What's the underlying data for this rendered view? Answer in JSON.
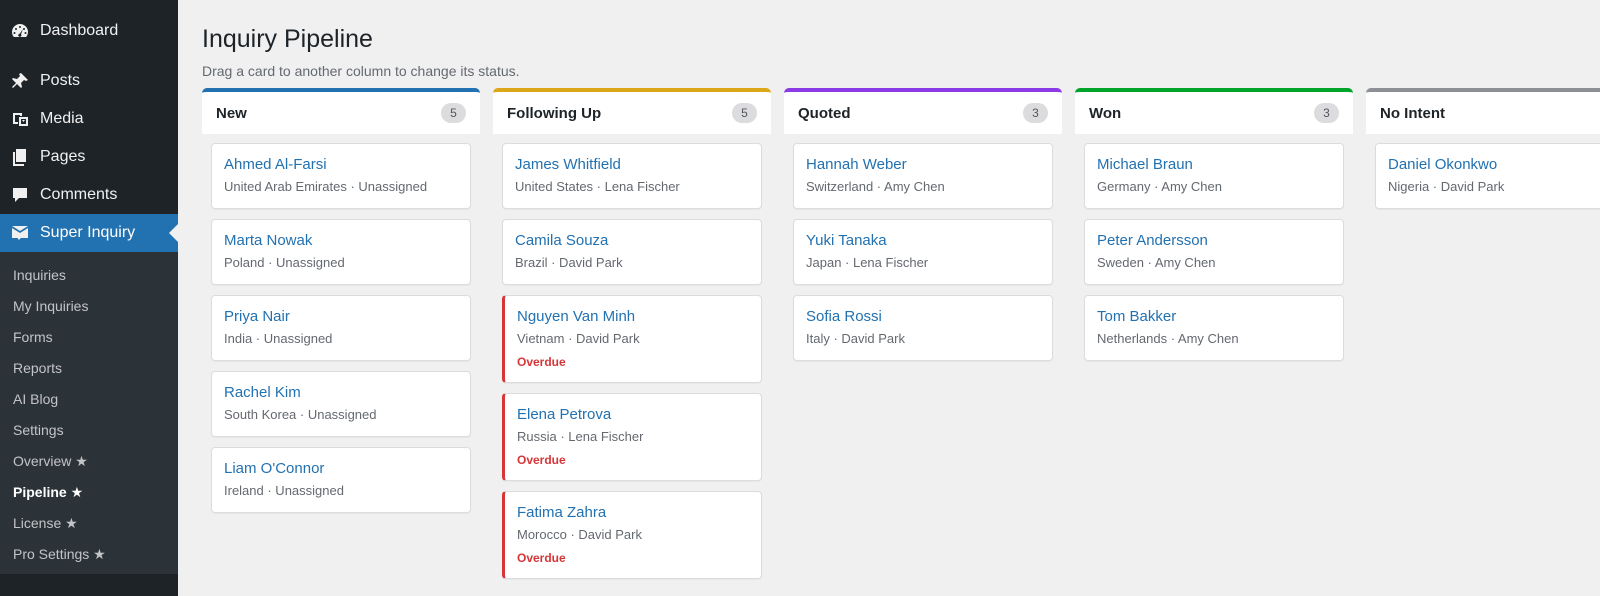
{
  "sidebar": {
    "menu": [
      {
        "label": "Dashboard",
        "icon": "dashboard-icon"
      },
      {
        "label": "Posts",
        "icon": "pin-icon"
      },
      {
        "label": "Media",
        "icon": "media-icon"
      },
      {
        "label": "Pages",
        "icon": "pages-icon"
      },
      {
        "label": "Comments",
        "icon": "comment-icon"
      },
      {
        "label": "Super Inquiry",
        "icon": "super-inquiry-icon"
      }
    ],
    "submenu": [
      "Inquiries",
      "My Inquiries",
      "Forms",
      "Reports",
      "AI Blog",
      "Settings",
      "Overview ★",
      "Pipeline ★",
      "License ★",
      "Pro Settings ★"
    ]
  },
  "page": {
    "title": "Inquiry Pipeline",
    "description": "Drag a card to another column to change its status."
  },
  "columns": [
    {
      "title": "New",
      "count": "5",
      "color": "#2271b1",
      "cards": [
        {
          "name": "Ahmed Al-Farsi",
          "meta": "United Arab Emirates · Unassigned"
        },
        {
          "name": "Marta Nowak",
          "meta": "Poland · Unassigned"
        },
        {
          "name": "Priya Nair",
          "meta": "India · Unassigned"
        },
        {
          "name": "Rachel Kim",
          "meta": "South Korea · Unassigned"
        },
        {
          "name": "Liam O'Connor",
          "meta": "Ireland · Unassigned"
        }
      ]
    },
    {
      "title": "Following Up",
      "count": "5",
      "color": "#dba617",
      "cards": [
        {
          "name": "James Whitfield",
          "meta": "United States · Lena Fischer"
        },
        {
          "name": "Camila Souza",
          "meta": "Brazil · David Park"
        },
        {
          "name": "Nguyen Van Minh",
          "meta": "Vietnam · David Park",
          "flag": "Overdue"
        },
        {
          "name": "Elena Petrova",
          "meta": "Russia · Lena Fischer",
          "flag": "Overdue"
        },
        {
          "name": "Fatima Zahra",
          "meta": "Morocco · David Park",
          "flag": "Overdue"
        }
      ]
    },
    {
      "title": "Quoted",
      "count": "3",
      "color": "#8c3ae6",
      "cards": [
        {
          "name": "Hannah Weber",
          "meta": "Switzerland · Amy Chen"
        },
        {
          "name": "Yuki Tanaka",
          "meta": "Japan · Lena Fischer"
        },
        {
          "name": "Sofia Rossi",
          "meta": "Italy · David Park"
        }
      ]
    },
    {
      "title": "Won",
      "count": "3",
      "color": "#00a32a",
      "cards": [
        {
          "name": "Michael Braun",
          "meta": "Germany · Amy Chen"
        },
        {
          "name": "Peter Andersson",
          "meta": "Sweden · Amy Chen"
        },
        {
          "name": "Tom Bakker",
          "meta": "Netherlands · Amy Chen"
        }
      ]
    },
    {
      "title": "No Intent",
      "count": "",
      "color": "#8c8f94",
      "cards": [
        {
          "name": "Daniel Okonkwo",
          "meta": "Nigeria · David Park"
        }
      ]
    }
  ]
}
